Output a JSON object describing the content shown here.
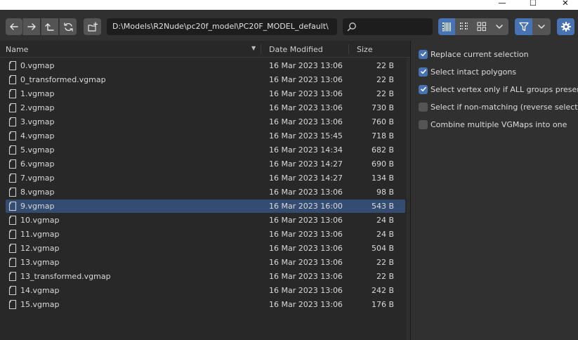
{
  "window": {
    "minimize_glyph": "—",
    "maximize_glyph": "☐",
    "close_glyph": "✕"
  },
  "toolbar": {
    "path": "D:\\Models\\R2Nude\\pc20f_model\\PC20F_MODEL_default\\",
    "search_value": "",
    "icons": [
      "back-icon",
      "forward-icon",
      "parent-directory-icon",
      "refresh-icon",
      "new-folder-icon",
      "search-icon",
      "vertical-list-icon",
      "horizontal-list-icon",
      "thumbnails-icon",
      "chevron-down-icon",
      "filter-icon",
      "chevron-down-icon",
      "settings-gear-icon"
    ],
    "active_display_mode": "vertical-list",
    "accent_color": "#4772b3"
  },
  "filelist": {
    "columns": {
      "name": "Name",
      "date": "Date Modified",
      "size": "Size"
    },
    "files": [
      {
        "name": "0.vgmap",
        "date": "16 Mar 2023 13:06",
        "size": "22 B"
      },
      {
        "name": "0_transformed.vgmap",
        "date": "16 Mar 2023 13:06",
        "size": "22 B"
      },
      {
        "name": "1.vgmap",
        "date": "16 Mar 2023 13:06",
        "size": "22 B"
      },
      {
        "name": "2.vgmap",
        "date": "16 Mar 2023 13:06",
        "size": "730 B"
      },
      {
        "name": "3.vgmap",
        "date": "16 Mar 2023 13:06",
        "size": "760 B"
      },
      {
        "name": "4.vgmap",
        "date": "16 Mar 2023 15:45",
        "size": "718 B"
      },
      {
        "name": "5.vgmap",
        "date": "16 Mar 2023 14:34",
        "size": "682 B"
      },
      {
        "name": "6.vgmap",
        "date": "16 Mar 2023 14:27",
        "size": "690 B"
      },
      {
        "name": "7.vgmap",
        "date": "16 Mar 2023 14:27",
        "size": "134 B"
      },
      {
        "name": "8.vgmap",
        "date": "16 Mar 2023 13:06",
        "size": "98 B"
      },
      {
        "name": "9.vgmap",
        "date": "16 Mar 2023 16:00",
        "size": "543 B",
        "selected": true
      },
      {
        "name": "10.vgmap",
        "date": "16 Mar 2023 13:06",
        "size": "24 B"
      },
      {
        "name": "11.vgmap",
        "date": "16 Mar 2023 13:06",
        "size": "24 B"
      },
      {
        "name": "12.vgmap",
        "date": "16 Mar 2023 13:06",
        "size": "504 B"
      },
      {
        "name": "13.vgmap",
        "date": "16 Mar 2023 13:06",
        "size": "22 B"
      },
      {
        "name": "13_transformed.vgmap",
        "date": "16 Mar 2023 13:06",
        "size": "22 B"
      },
      {
        "name": "14.vgmap",
        "date": "16 Mar 2023 13:06",
        "size": "242 B"
      },
      {
        "name": "15.vgmap",
        "date": "16 Mar 2023 13:06",
        "size": "176 B"
      }
    ]
  },
  "options": [
    {
      "label": "Replace current selection",
      "checked": true
    },
    {
      "label": "Select intact polygons",
      "checked": true
    },
    {
      "label": "Select vertex only if ALL groups present",
      "checked": true
    },
    {
      "label": "Select if non-matching (reverse select)",
      "checked": false
    },
    {
      "label": "Combine multiple VGMaps into one",
      "checked": false
    }
  ]
}
